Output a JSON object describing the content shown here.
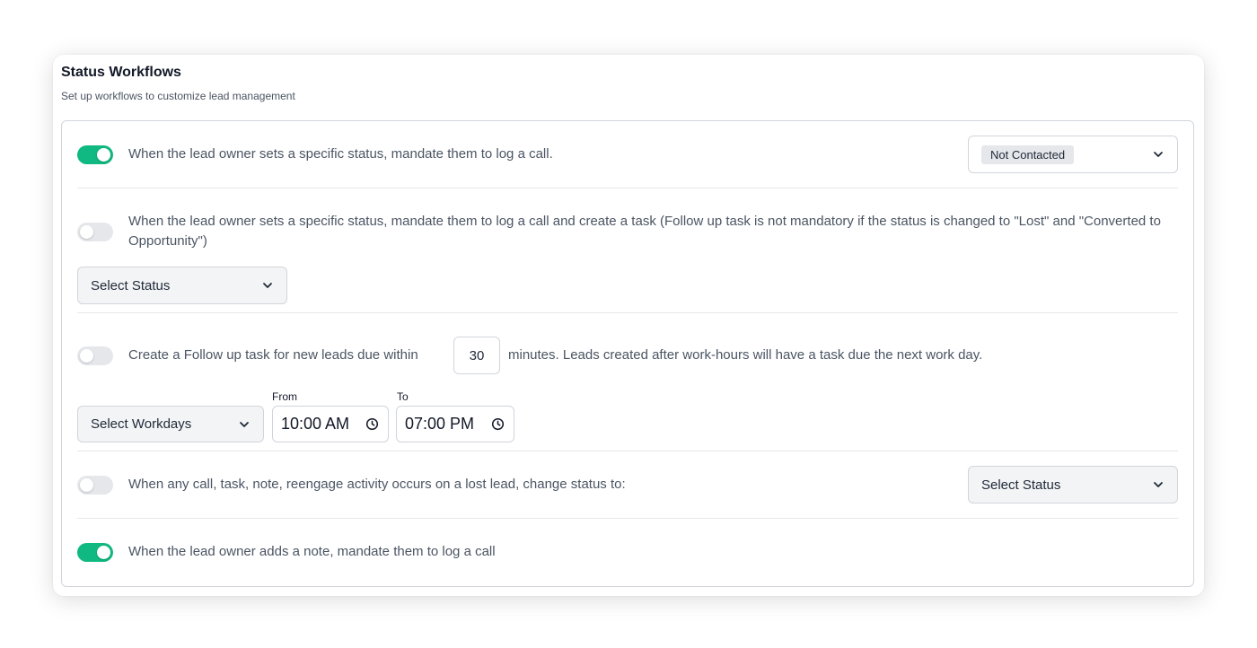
{
  "header": {
    "title": "Status Workflows",
    "subtitle": "Set up workflows to customize lead management"
  },
  "colors": {
    "toggle_on": "#10b981",
    "toggle_off": "#e5e7eb"
  },
  "rules": [
    {
      "enabled": true,
      "text": "When the lead owner sets a specific status, mandate them to log a call.",
      "select_value": "Not Contacted"
    },
    {
      "enabled": false,
      "text": "When the lead owner sets a specific status, mandate them to log a call and create a task (Follow up task is not mandatory if the status is changed to \"Lost\" and \"Converted to Opportunity\")",
      "select_value": "Select Status"
    },
    {
      "enabled": false,
      "text_before": "Create a Follow up task for new leads due within",
      "minutes": "30",
      "text_after": "minutes. Leads created after work-hours will have a task due the next work day.",
      "workdays_select": "Select Workdays",
      "from_label": "From",
      "from_time": "10:00 AM",
      "to_label": "To",
      "to_time": "07:00 PM"
    },
    {
      "enabled": false,
      "text": "When any call, task, note, reengage activity occurs on a lost lead, change status to:",
      "select_value": "Select Status"
    },
    {
      "enabled": true,
      "text": "When the lead owner adds a note, mandate them to log a call"
    }
  ],
  "icons": {
    "chevron": "chevron-down-icon",
    "clock": "clock-icon"
  }
}
